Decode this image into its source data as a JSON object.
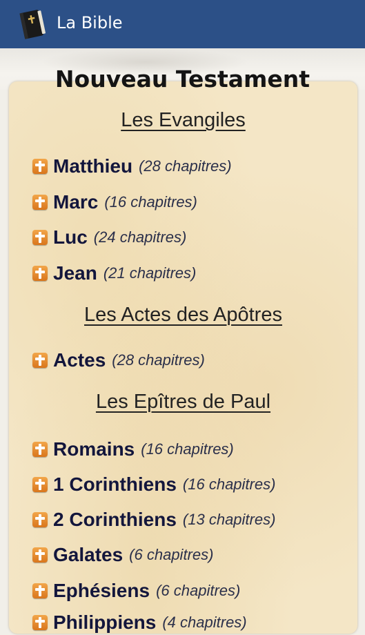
{
  "app": {
    "title": "La Bible",
    "icon": "bible-book-icon"
  },
  "page": {
    "title": "Nouveau Testament"
  },
  "sections": [
    {
      "heading": "Les Evangiles",
      "books": [
        {
          "name": "Matthieu",
          "count": "(28 chapitres)"
        },
        {
          "name": "Marc",
          "count": "(16 chapitres)"
        },
        {
          "name": "Luc",
          "count": "(24 chapitres)"
        },
        {
          "name": "Jean",
          "count": "(21 chapitres)"
        }
      ]
    },
    {
      "heading": "Les Actes des Apôtres",
      "books": [
        {
          "name": "Actes",
          "count": "(28 chapitres)"
        }
      ]
    },
    {
      "heading": "Les Epîtres de Paul",
      "books": [
        {
          "name": "Romains",
          "count": "(16 chapitres)"
        },
        {
          "name": "1 Corinthiens",
          "count": "(16 chapitres)"
        },
        {
          "name": "2 Corinthiens",
          "count": "(13 chapitres)"
        },
        {
          "name": "Galates",
          "count": "(6 chapitres)"
        },
        {
          "name": "Ephésiens",
          "count": "(6 chapitres)"
        },
        {
          "name": "Philippiens",
          "count": "(4 chapitres)"
        }
      ]
    }
  ],
  "colors": {
    "action_bar": "#2c5087",
    "icon_orange": "#e08a2e",
    "parchment": "#f4e6c6"
  }
}
